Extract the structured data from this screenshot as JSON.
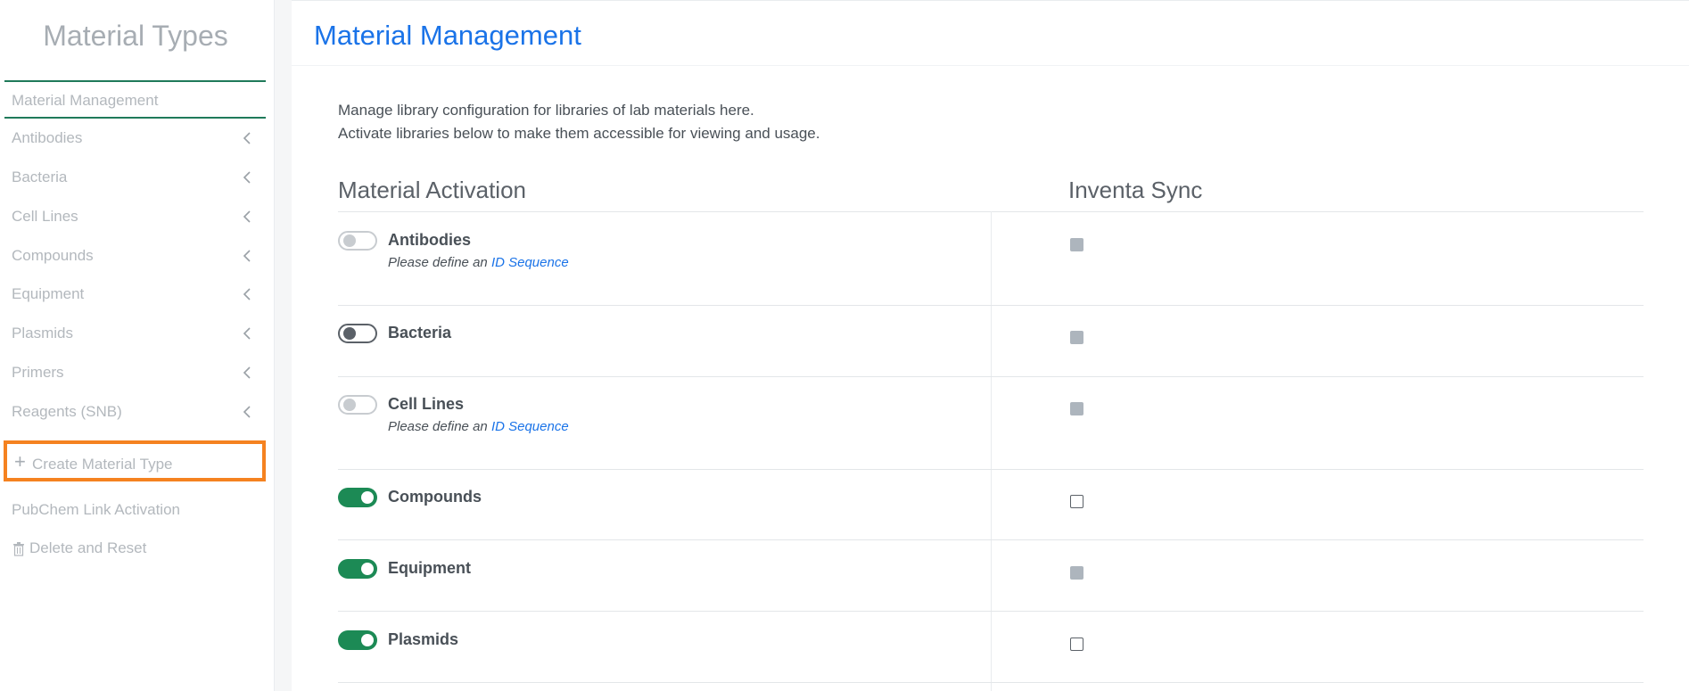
{
  "sidebar": {
    "title": "Material Types",
    "active_item": "Material Management",
    "items": [
      {
        "label": "Antibodies"
      },
      {
        "label": "Bacteria"
      },
      {
        "label": "Cell Lines"
      },
      {
        "label": "Compounds"
      },
      {
        "label": "Equipment"
      },
      {
        "label": "Plasmids"
      },
      {
        "label": "Primers"
      },
      {
        "label": "Reagents (SNB)"
      }
    ],
    "create_label": "Create Material Type",
    "pubchem_label": "PubChem Link Activation",
    "delete_label": "Delete and Reset"
  },
  "main": {
    "title": "Material Management",
    "description_line1": "Manage library configuration for libraries of lab materials here.",
    "description_line2": "Activate libraries below to make them accessible for viewing and usage.",
    "col_activation": "Material Activation",
    "col_sync": "Inventa Sync",
    "note_prefix": "Please define an",
    "note_link": "ID Sequence",
    "rows": [
      {
        "name": "Antibodies",
        "toggle": "off-disabled",
        "sync": "disabled",
        "note": true
      },
      {
        "name": "Bacteria",
        "toggle": "off",
        "sync": "disabled",
        "note": false
      },
      {
        "name": "Cell Lines",
        "toggle": "off-disabled",
        "sync": "disabled",
        "note": true
      },
      {
        "name": "Compounds",
        "toggle": "on",
        "sync": "unchecked",
        "note": false
      },
      {
        "name": "Equipment",
        "toggle": "on",
        "sync": "disabled",
        "note": false
      },
      {
        "name": "Plasmids",
        "toggle": "on",
        "sync": "unchecked",
        "note": false
      }
    ]
  },
  "colors": {
    "accent_blue": "#1a73e8",
    "toggle_on": "#1c8a55",
    "highlight_orange": "#f58220",
    "active_border": "#1f7a5a"
  }
}
